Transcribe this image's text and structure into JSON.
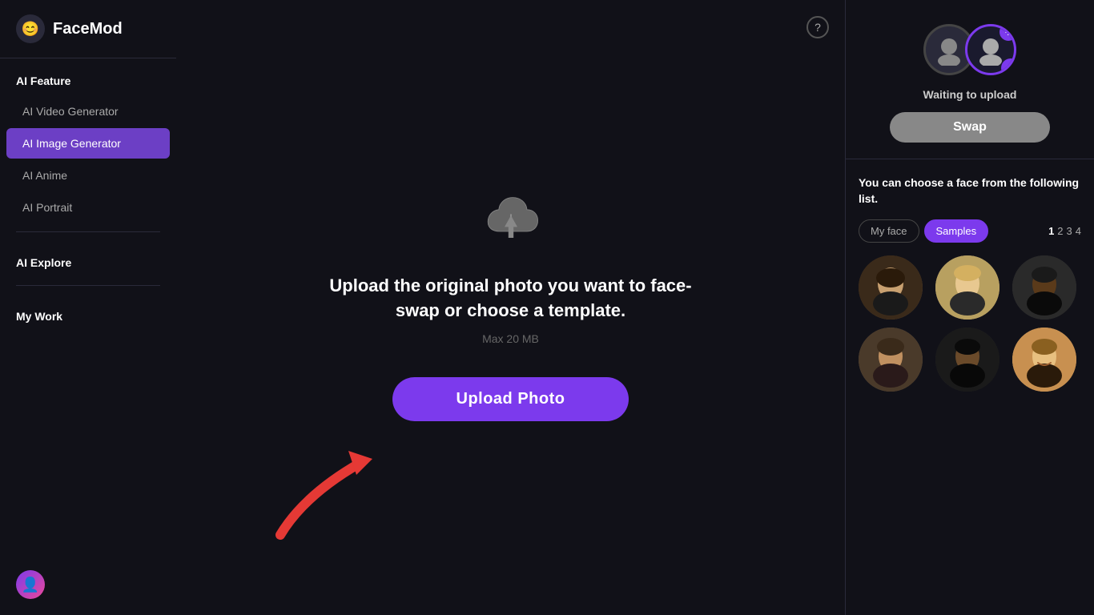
{
  "app": {
    "logo_icon": "😊",
    "logo_text": "FaceMod"
  },
  "sidebar": {
    "section_ai_feature": "AI Feature",
    "section_ai_explore": "AI Explore",
    "section_my_work": "My Work",
    "items": [
      {
        "id": "ai-video-generator",
        "label": "AI Video Generator",
        "active": false
      },
      {
        "id": "ai-image-generator",
        "label": "AI Image Generator",
        "active": true
      },
      {
        "id": "ai-anime",
        "label": "AI Anime",
        "active": false
      },
      {
        "id": "ai-portrait",
        "label": "AI Portrait",
        "active": false
      }
    ],
    "user_icon": "👤"
  },
  "upload_area": {
    "help_label": "?",
    "title": "Upload the original photo you want to face-swap or choose a template.",
    "subtitle": "Max 20 MB",
    "upload_button_label": "Upload Photo"
  },
  "right_panel": {
    "waiting_text": "Waiting to upload",
    "swap_button_label": "Swap",
    "chooser_title": "You can choose a face from the following list.",
    "tab_my_face": "My face",
    "tab_samples": "Samples",
    "page_numbers": [
      "1",
      "2",
      "3",
      "4"
    ],
    "active_page": "1"
  }
}
